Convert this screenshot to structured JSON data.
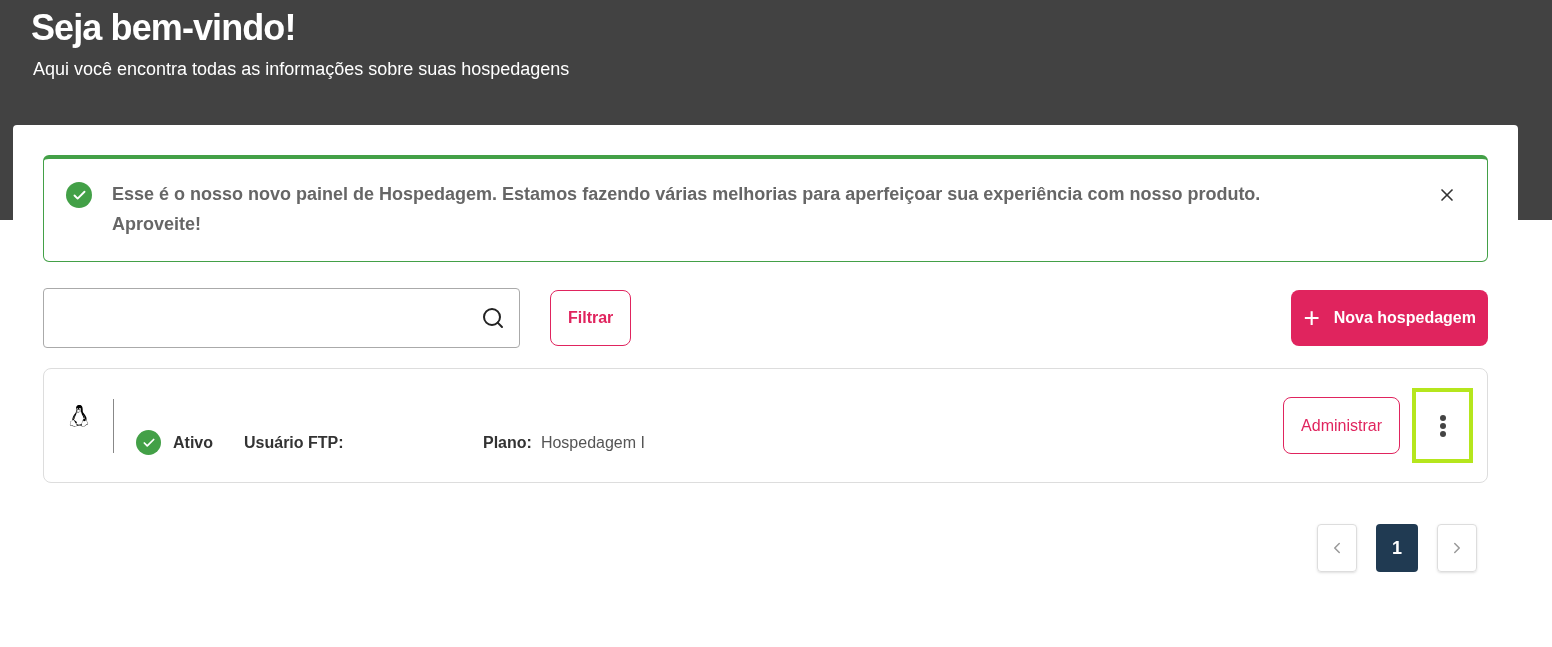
{
  "header": {
    "title": "Seja bem-vindo!",
    "subtitle": "Aqui você encontra todas as informações sobre suas hospedagens"
  },
  "alert": {
    "message": "Esse é o nosso novo painel de Hospedagem. Estamos fazendo várias melhorias para aperfeiçoar sua experiência com nosso produto. Aproveite!"
  },
  "filter_button": "Filtrar",
  "new_button": {
    "icon": "+",
    "label": "Nova hospedagem"
  },
  "hostings": [
    {
      "status": "Ativo",
      "active": true,
      "ftp_label": "Usuário FTP:",
      "plan_label": "Plano:",
      "plan": "Hospedagem I",
      "manage_button": "Administrar",
      "menu_highlighted": true
    }
  ],
  "pagination": {
    "pages": [
      {
        "label": "1",
        "selected": true
      }
    ]
  }
}
